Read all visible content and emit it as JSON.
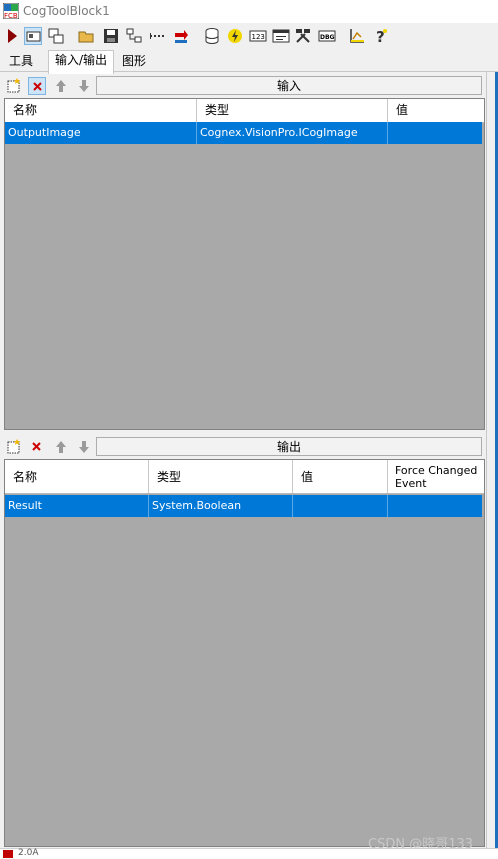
{
  "window": {
    "title": "CogToolBlock1"
  },
  "tabs": [
    {
      "label": "工具"
    },
    {
      "label": "输入/输出"
    },
    {
      "label": "图形"
    }
  ],
  "toolbar_icons": [
    "run-icon",
    "display-icon",
    "tool-window-icon",
    "open-icon",
    "save-icon",
    "network-icon",
    "terminal-icon",
    "import-icon",
    "database-icon",
    "lightning-icon",
    "counter-icon",
    "terminal-window-icon",
    "tools-icon",
    "debug-icon",
    "chart-icon",
    "help-icon"
  ],
  "inputs": {
    "section_label": "输入",
    "columns": [
      "名称",
      "类型",
      "值"
    ],
    "rows": [
      {
        "name": "OutputImage",
        "type": "Cognex.VisionPro.ICogImage",
        "value": ""
      }
    ]
  },
  "outputs": {
    "section_label": "输出",
    "columns": [
      "名称",
      "类型",
      "值",
      "Force Changed Event"
    ],
    "rows": [
      {
        "name": "Result",
        "type": "System.Boolean",
        "value": "",
        "force_changed": false
      }
    ]
  },
  "watermark": "CSDN @晓哥133",
  "status": {
    "text": "2.0A"
  },
  "colors": {
    "selection": "#0078d7",
    "grid_bg": "#a9a9a9",
    "accent_bar": "#1f6fbf"
  }
}
